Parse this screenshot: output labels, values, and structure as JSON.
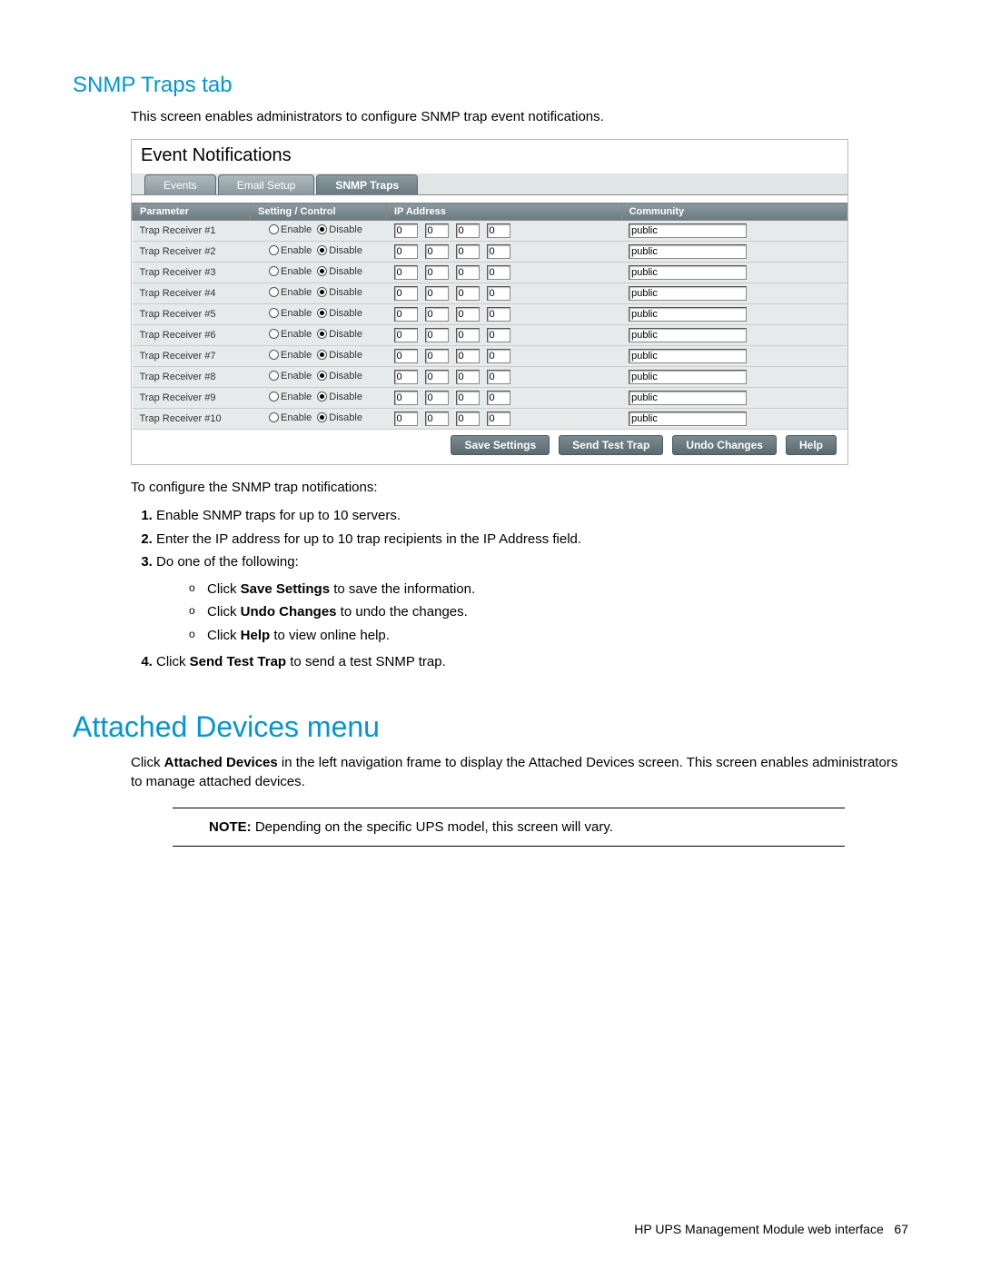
{
  "headings": {
    "snmp_traps_tab": "SNMP Traps tab",
    "attached_devices_menu": "Attached Devices menu"
  },
  "intro_text": "This screen enables administrators to configure SNMP trap event notifications.",
  "screenshot": {
    "title": "Event Notifications",
    "tabs": [
      "Events",
      "Email Setup",
      "SNMP Traps"
    ],
    "active_tab_index": 2,
    "columns": [
      "Parameter",
      "Setting / Control",
      "IP Address",
      "Community"
    ],
    "radio_labels": {
      "enable": "Enable",
      "disable": "Disable"
    },
    "rows": [
      {
        "param": "Trap Receiver #1",
        "disabled": true,
        "ip": [
          "0",
          "0",
          "0",
          "0"
        ],
        "community": "public"
      },
      {
        "param": "Trap Receiver #2",
        "disabled": true,
        "ip": [
          "0",
          "0",
          "0",
          "0"
        ],
        "community": "public"
      },
      {
        "param": "Trap Receiver #3",
        "disabled": true,
        "ip": [
          "0",
          "0",
          "0",
          "0"
        ],
        "community": "public"
      },
      {
        "param": "Trap Receiver #4",
        "disabled": true,
        "ip": [
          "0",
          "0",
          "0",
          "0"
        ],
        "community": "public"
      },
      {
        "param": "Trap Receiver #5",
        "disabled": true,
        "ip": [
          "0",
          "0",
          "0",
          "0"
        ],
        "community": "public"
      },
      {
        "param": "Trap Receiver #6",
        "disabled": true,
        "ip": [
          "0",
          "0",
          "0",
          "0"
        ],
        "community": "public"
      },
      {
        "param": "Trap Receiver #7",
        "disabled": true,
        "ip": [
          "0",
          "0",
          "0",
          "0"
        ],
        "community": "public"
      },
      {
        "param": "Trap Receiver #8",
        "disabled": true,
        "ip": [
          "0",
          "0",
          "0",
          "0"
        ],
        "community": "public"
      },
      {
        "param": "Trap Receiver #9",
        "disabled": true,
        "ip": [
          "0",
          "0",
          "0",
          "0"
        ],
        "community": "public"
      },
      {
        "param": "Trap Receiver #10",
        "disabled": true,
        "ip": [
          "0",
          "0",
          "0",
          "0"
        ],
        "community": "public"
      }
    ],
    "buttons": [
      "Save Settings",
      "Send Test Trap",
      "Undo Changes",
      "Help"
    ]
  },
  "configure_intro": "To configure the SNMP trap notifications:",
  "steps": {
    "s1": "Enable SNMP traps for up to 10 servers.",
    "s2": "Enter the IP address for up to 10 trap recipients in the IP Address field.",
    "s3": "Do one of the following:",
    "s3a_pre": "Click ",
    "s3a_b": "Save Settings",
    "s3a_post": " to save the information.",
    "s3b_pre": "Click ",
    "s3b_b": "Undo Changes",
    "s3b_post": " to undo the changes.",
    "s3c_pre": "Click ",
    "s3c_b": "Help",
    "s3c_post": " to view online help.",
    "s4_pre": "Click ",
    "s4_b": "Send Test Trap",
    "s4_post": " to send a test SNMP trap."
  },
  "attached_devices_body_pre": "Click ",
  "attached_devices_body_b": "Attached Devices",
  "attached_devices_body_post": " in the left navigation frame to display the Attached Devices screen. This screen enables administrators to manage attached devices.",
  "note_label": "NOTE:",
  "note_text": " Depending on the specific UPS model, this screen will vary.",
  "footer_text": "HP UPS Management Module web interface",
  "footer_page": "67"
}
